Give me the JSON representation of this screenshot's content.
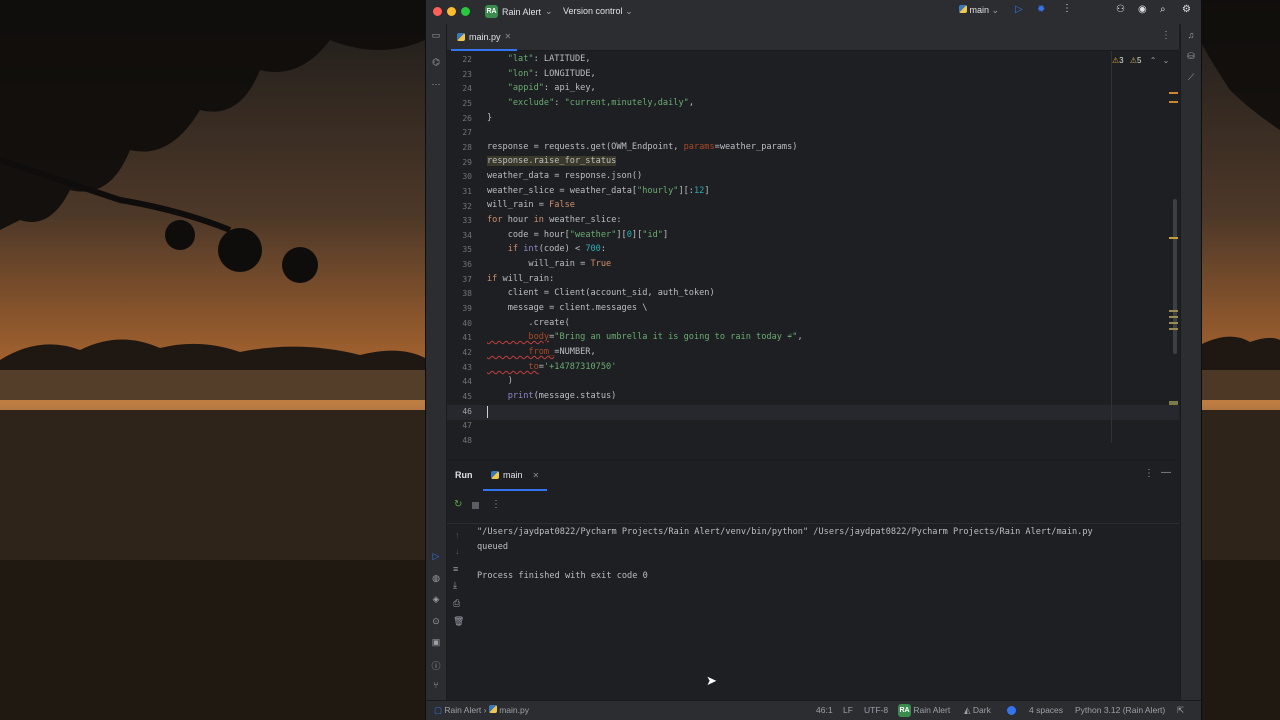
{
  "titlebar": {
    "project_badge": "RA",
    "project_name": "Rain Alert",
    "version_control": "Version control",
    "run_config": "main"
  },
  "editor_tab": {
    "label": "main.py"
  },
  "inspections": {
    "warnings": "3",
    "weak_warnings": "5"
  },
  "code_lines": [
    {
      "n": "22"
    },
    {
      "n": "23"
    },
    {
      "n": "24"
    },
    {
      "n": "25"
    },
    {
      "n": "26"
    },
    {
      "n": "27"
    },
    {
      "n": "28"
    },
    {
      "n": "29"
    },
    {
      "n": "30"
    },
    {
      "n": "31"
    },
    {
      "n": "32"
    },
    {
      "n": "33"
    },
    {
      "n": "34"
    },
    {
      "n": "35"
    },
    {
      "n": "36"
    },
    {
      "n": "37"
    },
    {
      "n": "38"
    },
    {
      "n": "39"
    },
    {
      "n": "40"
    },
    {
      "n": "41"
    },
    {
      "n": "42"
    },
    {
      "n": "43"
    },
    {
      "n": "44"
    },
    {
      "n": "45"
    },
    {
      "n": "46"
    },
    {
      "n": "47"
    },
    {
      "n": "48"
    }
  ],
  "code": {
    "l22": "    \"lat\": LATITUDE,",
    "l23": "    \"lon\": LONGITUDE,",
    "l24": "    \"appid\": api_key,",
    "l25": "    \"exclude\": \"current,minutely,daily\",",
    "l26": "}",
    "l28_a": "response = requests.get(OWM_Endpoint, ",
    "l28_b": "params",
    "l28_c": "=weather_params)",
    "l29": "response.raise_for_status",
    "l30": "weather_data = response.json()",
    "l31_a": "weather_slice = weather_data[",
    "l31_b": "\"hourly\"",
    "l31_c": "][:",
    "l31_d": "12",
    "l31_e": "]",
    "l32_a": "will_rain = ",
    "l32_b": "False",
    "l33_a": "for",
    "l33_b": " hour ",
    "l33_c": "in",
    "l33_d": " weather_slice:",
    "l34_a": "    code = hour[",
    "l34_b": "\"weather\"",
    "l34_c": "][",
    "l34_d": "0",
    "l34_e": "][",
    "l34_f": "\"id\"",
    "l34_g": "]",
    "l35_a": "    if",
    "l35_b": " int",
    "l35_c": "(code) < ",
    "l35_d": "700",
    "l35_e": ":",
    "l36_a": "        will_rain = ",
    "l36_b": "True",
    "l37_a": "if",
    "l37_b": " will_rain:",
    "l38": "    client = Client(account_sid, auth_token)",
    "l39": "    message = client.messages \\",
    "l40": "        .create(",
    "l41_a": "        body",
    "l41_b": "=",
    "l41_c": "\"Bring an umbrella it is going to rain today ☔\"",
    "l41_d": ",",
    "l42_a": "        from_",
    "l42_b": "=NUMBER,",
    "l43_a": "        to",
    "l43_b": "=",
    "l43_c": "'+14787310750'",
    "l44": "    )",
    "l45_a": "    print",
    "l45_b": "(message.status)"
  },
  "run_panel": {
    "title": "Run",
    "tab_label": "main",
    "console": [
      "\"/Users/jaydpat0822/Pycharm Projects/Rain Alert/venv/bin/python\" /Users/jaydpat0822/Pycharm Projects/Rain Alert/main.py",
      "queued",
      "",
      "Process finished with exit code 0"
    ]
  },
  "statusbar": {
    "breadcrumb_project": "Rain Alert",
    "breadcrumb_file": "main.py",
    "position": "46:1",
    "line_sep": "LF",
    "encoding": "UTF-8",
    "badge": "RA",
    "project": "Rain Alert",
    "theme": "Dark",
    "indent": "4 spaces",
    "interpreter": "Python 3.12 (Rain Alert)"
  },
  "colors": {
    "accent": "#3574f0",
    "keyword": "#cf8e6d",
    "string": "#6aab73",
    "number": "#2aacb8",
    "project_badge": "#3b8a4e"
  }
}
